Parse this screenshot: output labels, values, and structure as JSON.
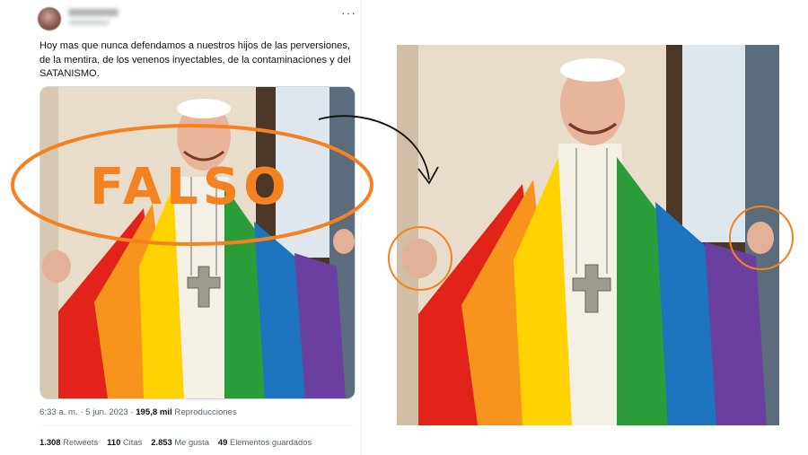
{
  "tweet": {
    "text": "Hoy mas que nunca defendamos a nuestros hijos de las perversiones, de la mentira, de los venenos inyectables, de la contaminaciones y del SATANISMO.",
    "time": "6:33 a. m. · 5 jun. 2023 ·",
    "views_count": "195,8 mil",
    "views_label": "Reproducciones",
    "more_glyph": "···",
    "stats": [
      {
        "count": "1.308",
        "label": "Retweets"
      },
      {
        "count": "110",
        "label": "Citas"
      },
      {
        "count": "2.853",
        "label": "Me gusta"
      },
      {
        "count": "49",
        "label": "Elementos guardados"
      }
    ]
  },
  "stamp": {
    "text": "FALSO"
  },
  "colors": {
    "accent_orange": "#f58220",
    "flag": [
      "#e2231a",
      "#f7941d",
      "#ffd200",
      "#2a9d3a",
      "#1e73be",
      "#6a3fa0"
    ]
  }
}
